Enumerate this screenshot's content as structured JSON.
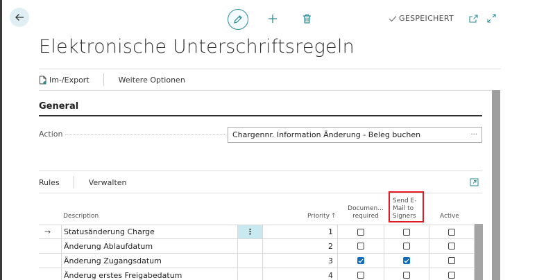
{
  "header": {
    "saved_label": "GESPEICHERT"
  },
  "page": {
    "title": "Elektronische Unterschriftsregeln"
  },
  "action_bar": {
    "import_export": "Im-/Export",
    "more_options": "Weitere Optionen"
  },
  "general": {
    "section_title": "General",
    "action_label": "Action",
    "action_value": "Chargennr. Information Änderung - Beleg buchen",
    "more_icon": "···"
  },
  "rules": {
    "tab_rules": "Rules",
    "tab_manage": "Verwalten",
    "columns": {
      "description": "Description",
      "priority": "Priority",
      "priority_sort": "↑",
      "doc_required_1": "Documen...",
      "doc_required_2": "required",
      "send_email_1": "Send E-",
      "send_email_2": "Mail to",
      "send_email_3": "Signers",
      "active": "Active"
    },
    "rows": [
      {
        "description": "Statusänderung Charge",
        "priority": "1",
        "doc_required": false,
        "send_email": false,
        "active": false,
        "current": true
      },
      {
        "description": "Änderung Ablaufdatum",
        "priority": "2",
        "doc_required": false,
        "send_email": false,
        "active": false,
        "current": false
      },
      {
        "description": "Änderung Zugangsdatum",
        "priority": "3",
        "doc_required": true,
        "send_email": true,
        "active": false,
        "current": false
      },
      {
        "description": "Änderug erstes Freigabedatum",
        "priority": "4",
        "doc_required": false,
        "send_email": false,
        "active": false,
        "current": false
      }
    ],
    "row_menu_icon": "⋮",
    "current_row_icon": "→"
  },
  "colors": {
    "accent": "#2a8a93",
    "checkbox_checked": "#0f6cbd",
    "highlight_box": "#e01b24",
    "selected_cell": "#c8e9ef"
  }
}
